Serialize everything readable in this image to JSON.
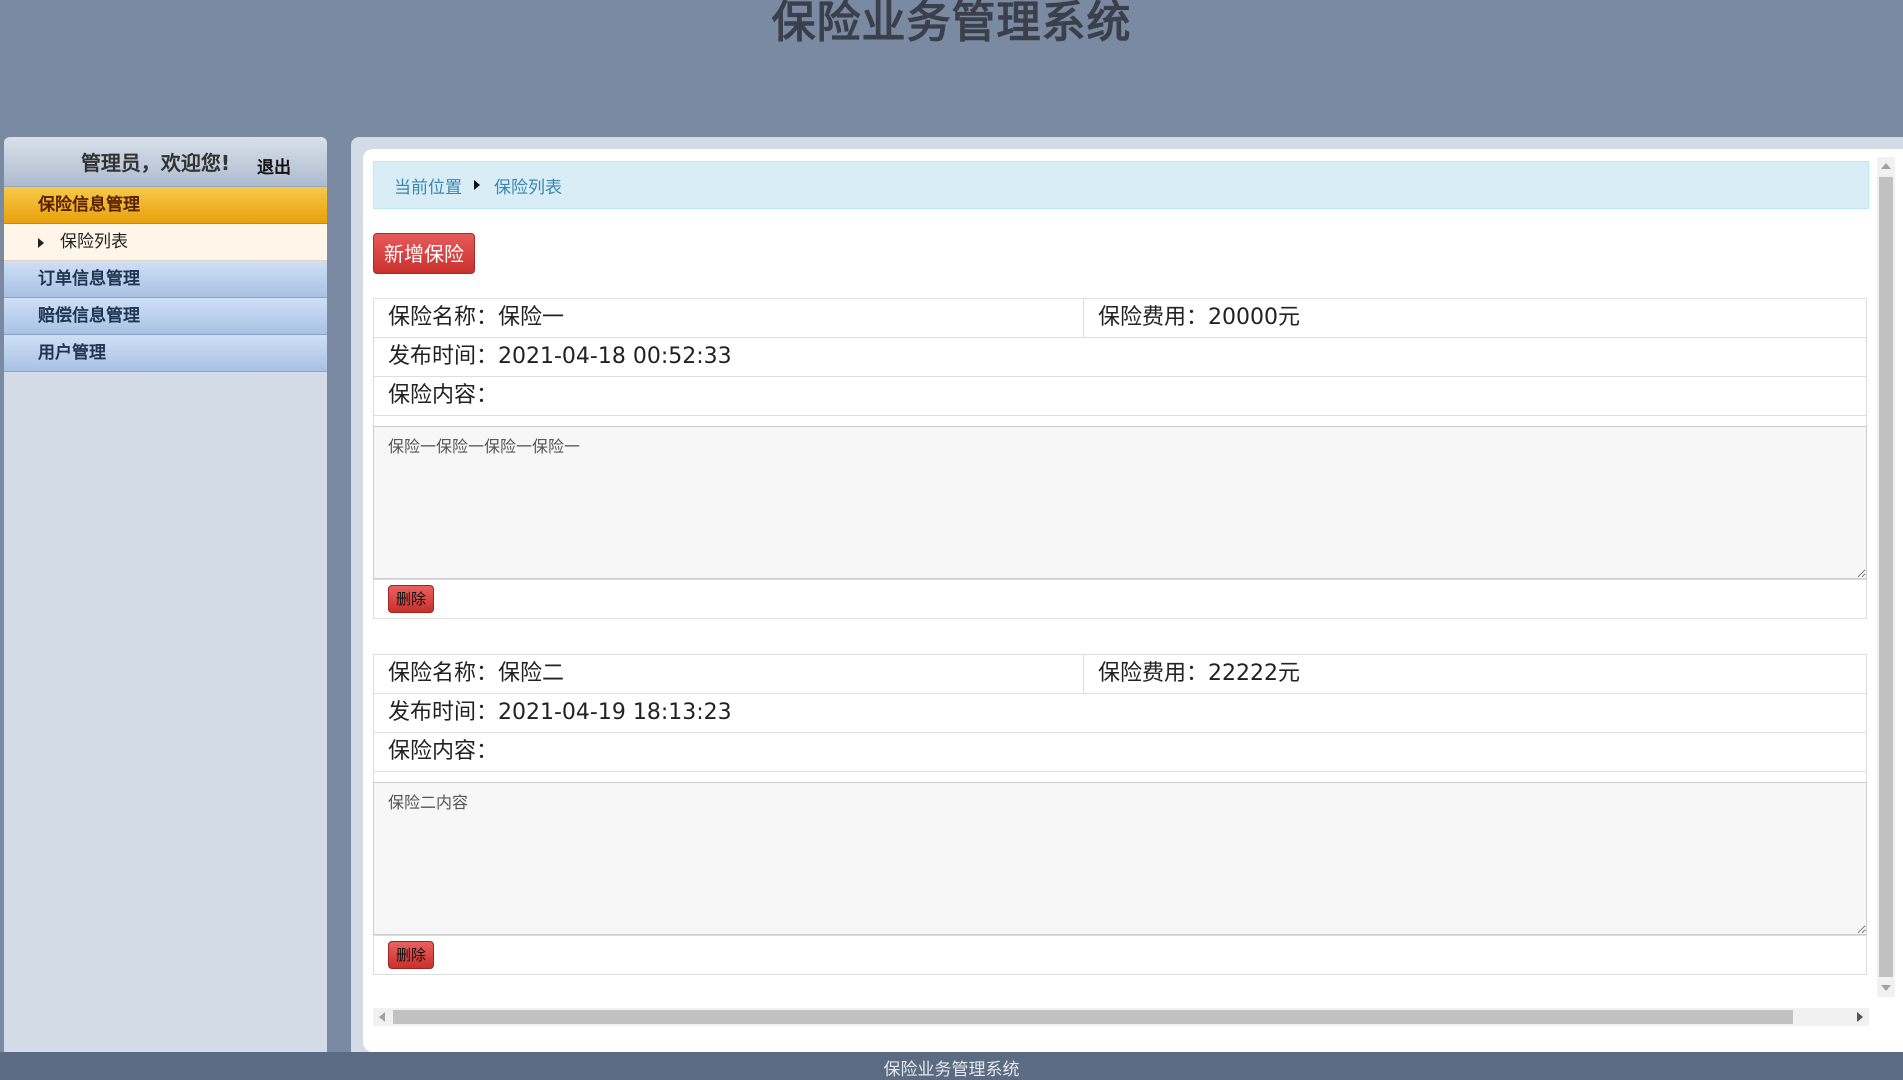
{
  "app": {
    "title": "保险业务管理系统"
  },
  "sidebar": {
    "welcome": "管理员，欢迎您!",
    "logout": "退出",
    "groups": [
      {
        "label": "保险信息管理",
        "active": true
      },
      {
        "label": "订单信息管理"
      },
      {
        "label": "赔偿信息管理"
      },
      {
        "label": "用户管理"
      }
    ],
    "subitems": [
      {
        "label": "保险列表"
      }
    ]
  },
  "breadcrumb": {
    "root": "当前位置",
    "current": "保险列表"
  },
  "toolbar": {
    "add_label": "新增保险"
  },
  "records": [
    {
      "name": "保险名称：保险一",
      "fee": "保险费用：20000元",
      "published": "发布时间：2021-04-18 00:52:33",
      "content_label": "保险内容：",
      "content": "保险一保险一保险一保险一",
      "delete_label": "删除"
    },
    {
      "name": "保险名称：保险二",
      "fee": "保险费用：22222元",
      "published": "发布时间：2021-04-19 18:13:23",
      "content_label": "保险内容：",
      "content": "保险二内容",
      "delete_label": "删除"
    }
  ],
  "footer": {
    "text": "保险业务管理系统"
  },
  "colors": {
    "header_bg": "#7b8aa3",
    "active_menu": "#e8a10c",
    "danger": "#c9302c",
    "breadcrumb_bg": "#d9edf7"
  }
}
